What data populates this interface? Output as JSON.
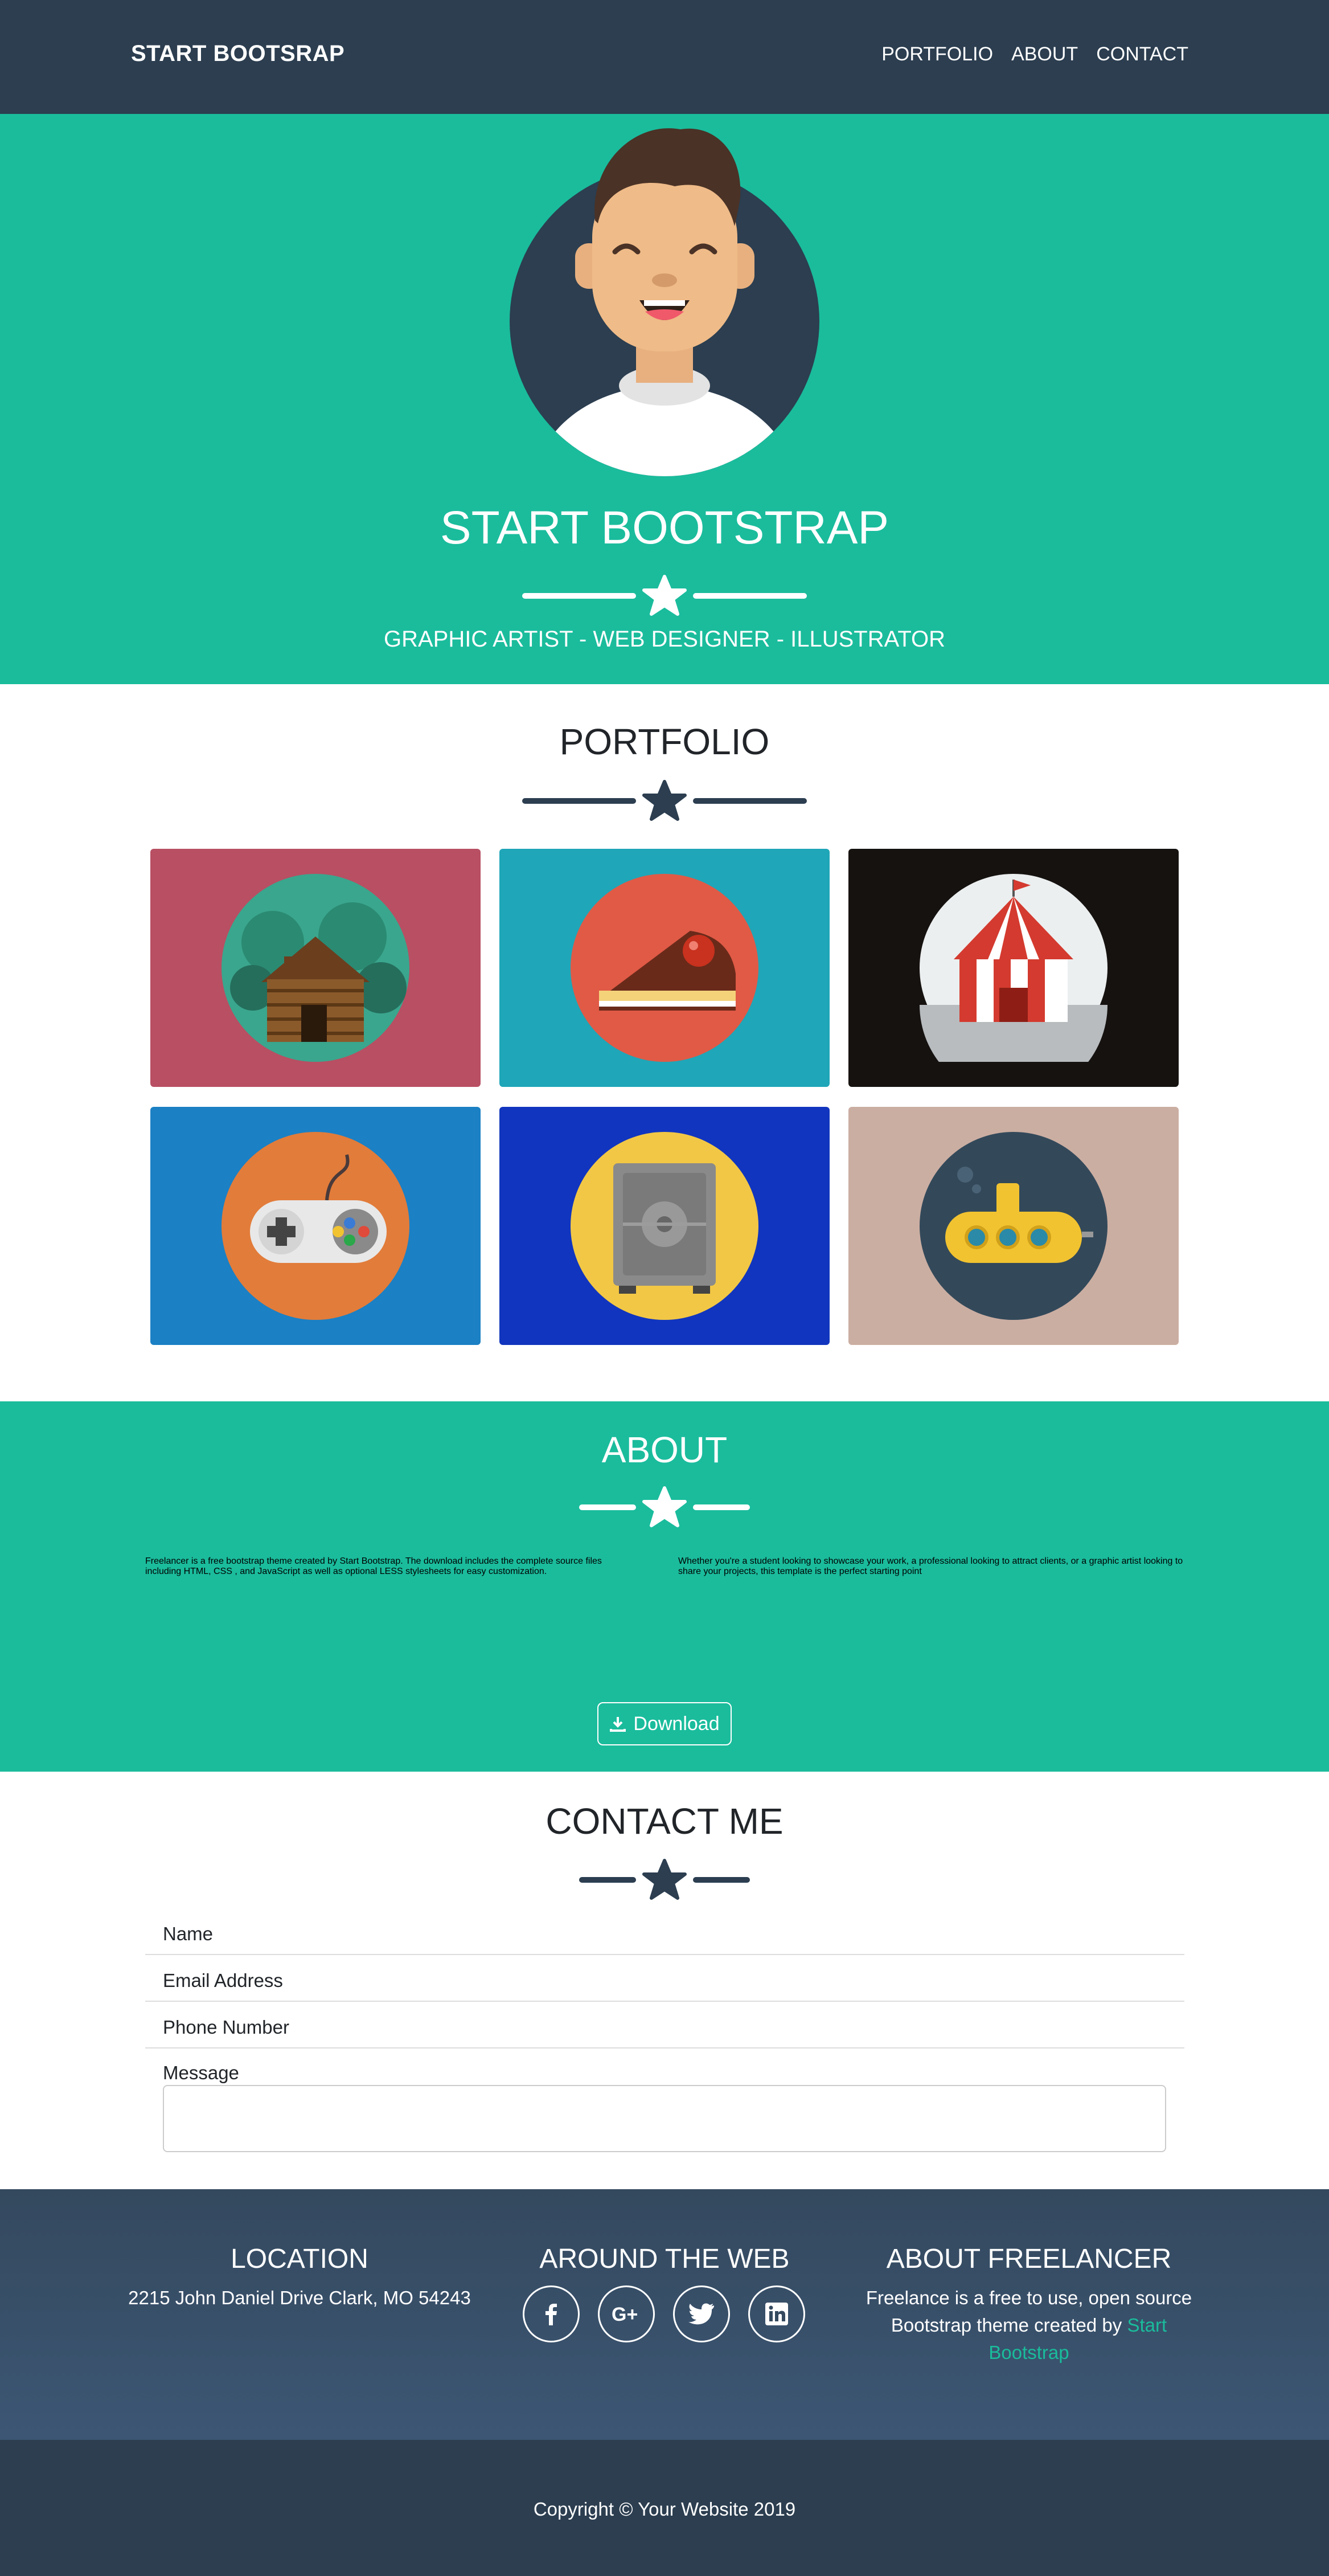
{
  "nav": {
    "brand": "START BOOTSRAP",
    "links": [
      "PORTFOLIO",
      "ABOUT",
      "CONTACT"
    ]
  },
  "masthead": {
    "title": "START BOOTSTRAP",
    "subtitle": "GRAPHIC ARTIST - WEB DESIGNER - ILLUSTRATOR"
  },
  "portfolio": {
    "title": "PORTFOLIO",
    "items": [
      {
        "name": "cabin",
        "bg": "#b84f63",
        "circle": "#3aa68d"
      },
      {
        "name": "cake",
        "bg": "#1fa6b8",
        "circle": "#e05a46"
      },
      {
        "name": "circus",
        "bg": "#161210",
        "circle": "#eceff0"
      },
      {
        "name": "game",
        "bg": "#1b80c4",
        "circle": "#e27c3a"
      },
      {
        "name": "safe",
        "bg": "#1135be",
        "circle": "#f2c745"
      },
      {
        "name": "submarine",
        "bg": "#cbaea2",
        "circle": "#33495a"
      }
    ]
  },
  "about": {
    "title": "ABOUT",
    "left": "Freelancer is a free bootstrap theme created by Start Bootstrap. The download includes the complete source files including HTML, CSS , and JavaScript as well as optional LESS stylesheets for easy customization.",
    "right": "Whether you're a student looking to showcase your work, a professional looking to attract clients, or a graphic artist looking to share your projects, this template is the perfect starting point",
    "button": "Download"
  },
  "contact": {
    "title": "CONTACT ME",
    "fields": [
      "Name",
      "Email Address",
      "Phone Number",
      "Message"
    ]
  },
  "footer": {
    "location_title": "LOCATION",
    "location": "2215 John Daniel Drive Clark, MO 54243",
    "web_title": "AROUND THE WEB",
    "social": [
      "facebook-icon",
      "google-plus-icon",
      "twitter-icon",
      "linkedin-icon"
    ],
    "about_title": "ABOUT FREELANCER",
    "about_text": "Freelance is a free to use, open source Bootstrap theme created by",
    "about_link": "Start Bootstrap",
    "copyright": "Copyright © Your Website 2019"
  },
  "colors": {
    "primary": "#1abc9c",
    "dark": "#2c3e50",
    "footer": "#34495e"
  }
}
